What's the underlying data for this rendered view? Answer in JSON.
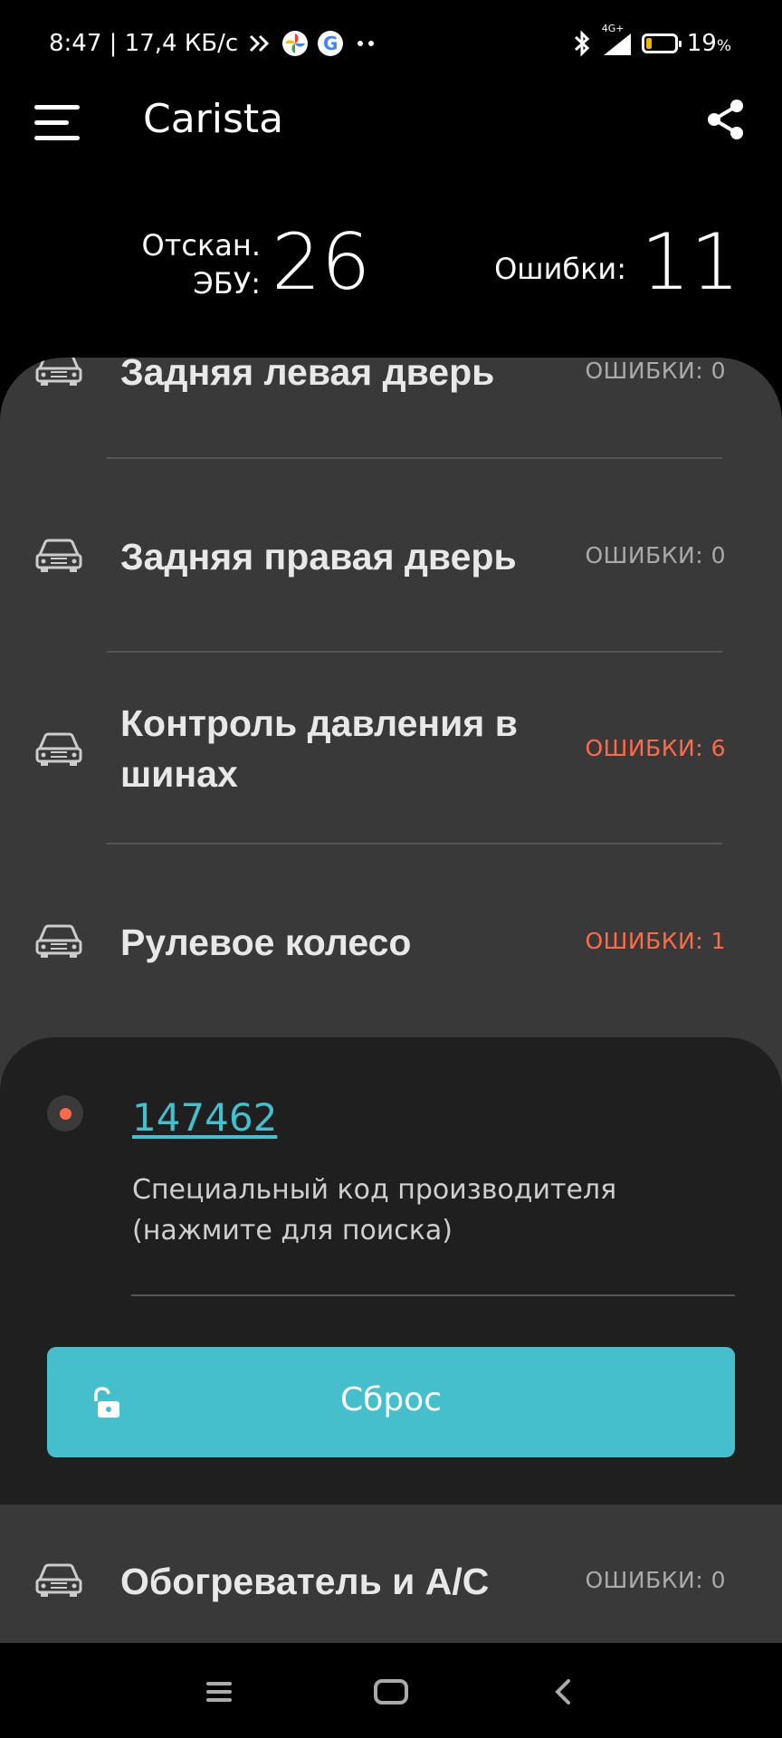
{
  "status_bar": {
    "time_info": "8:47 | 17,4 КБ/с",
    "network": "4G+",
    "battery": "19",
    "battery_unit": "%",
    "battery_level": 0.19
  },
  "app_bar": {
    "title": "Carista"
  },
  "summary": {
    "scanned_label_line1": "Отскан.",
    "scanned_label_line2": "ЭБУ:",
    "scanned_count": "26",
    "errors_label": "Ошибки:",
    "errors_count": "11"
  },
  "modules": [
    {
      "name": "Задняя левая дверь",
      "errors": "ОШИБКИ: 0",
      "has_errors": false
    },
    {
      "name": "Задняя правая дверь",
      "errors": "ОШИБКИ: 0",
      "has_errors": false
    },
    {
      "name": "Контроль давления в шинах",
      "errors": "ОШИБКИ: 6",
      "has_errors": true
    },
    {
      "name": "Рулевое колесо",
      "errors": "ОШИБКИ: 1",
      "has_errors": true
    },
    {
      "name": "Обогреватель и A/C",
      "errors": "ОШИБКИ: 0",
      "has_errors": false
    }
  ],
  "detail": {
    "code": "147462",
    "description": "Специальный код производителя (нажмите для поиска)",
    "reset_label": "Сброс"
  },
  "colors": {
    "accent": "#45bfcc",
    "error": "#ff6a48",
    "card": "#393939",
    "detail": "#1f1f1f"
  }
}
